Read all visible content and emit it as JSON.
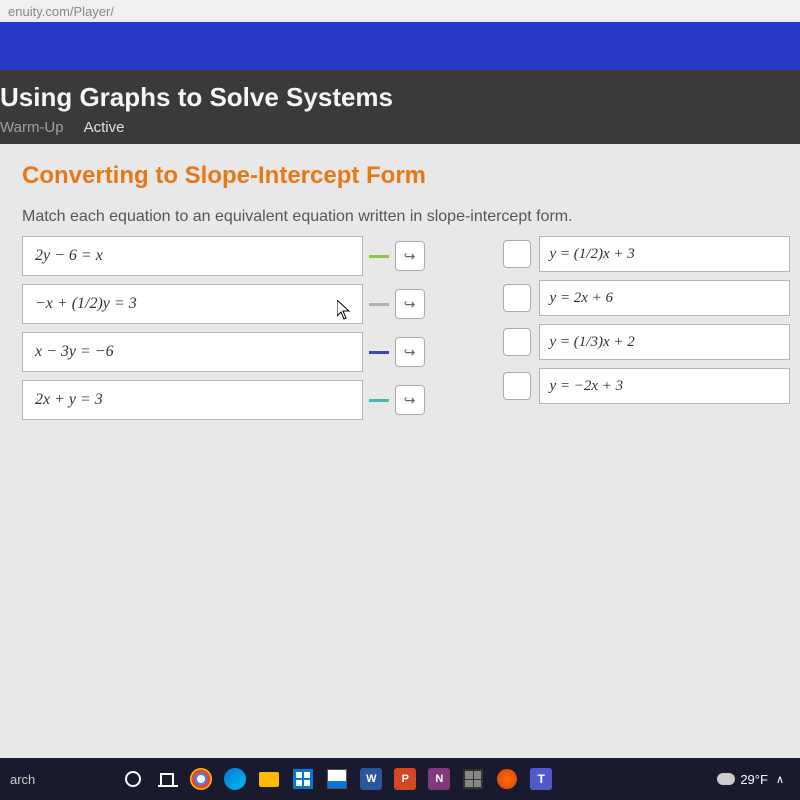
{
  "url": "enuity.com/Player/",
  "lesson_title": "Using Graphs to Solve Systems",
  "tabs": {
    "warmup": "Warm-Up",
    "active": "Active"
  },
  "section_title": "Converting to Slope-Intercept Form",
  "instruction": "Match each equation to an equivalent equation written in slope-intercept form.",
  "left_equations": [
    "2y − 6 = x",
    "−x + (1/2)y = 3",
    "x − 3y = −6",
    "2x + y = 3"
  ],
  "right_equations": [
    "y = (1/2)x + 3",
    "y = 2x + 6",
    "y = (1/3)x + 2",
    "y = −2x + 3"
  ],
  "taskbar": {
    "search": "arch",
    "word": "W",
    "ppt": "P",
    "onenote": "N",
    "teams": "T",
    "temp": "29°F",
    "chevron": "∧"
  }
}
